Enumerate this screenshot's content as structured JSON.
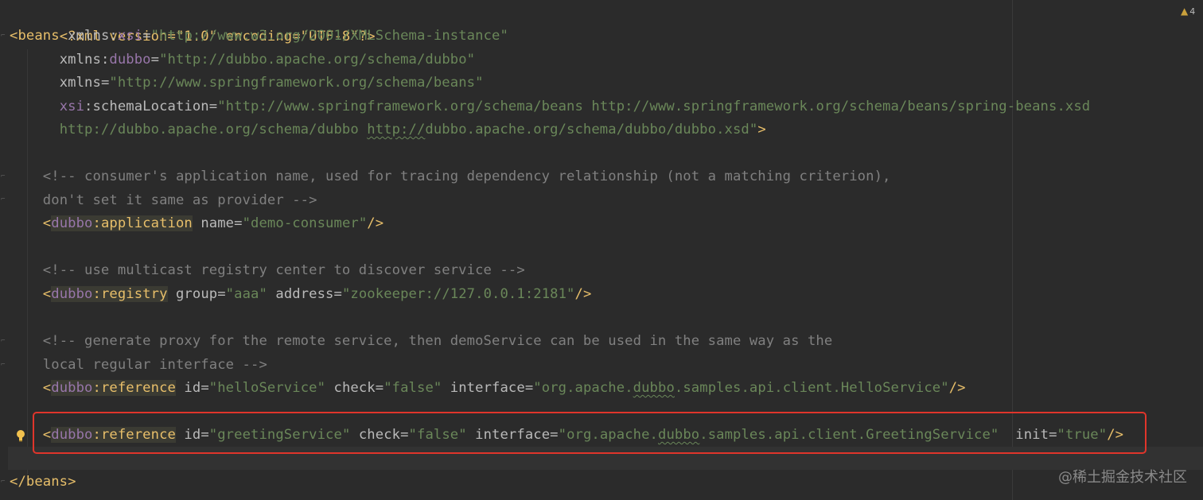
{
  "editor": {
    "warning_count": "4",
    "watermark": "@稀土掘金技术社区"
  },
  "code": {
    "l1_decl": "<?xml version=\"1.0\" encoding=\"UTF-8\"?>",
    "l2_open": "<",
    "l2_tag": "beans",
    "l2_attr_ns": "xmlns",
    "l2_colon": ":",
    "l2_xsi": "xsi",
    "l2_eq": "=",
    "l2_val": "\"http://www.w3.org/2001/XMLSchema-instance\"",
    "l3_ns": "xmlns",
    "l3_colon": ":",
    "l3_prefix": "dubbo",
    "l3_eq": "=",
    "l3_val": "\"http://dubbo.apache.org/schema/dubbo\"",
    "l4_ns": "xmlns",
    "l4_eq": "=",
    "l4_val": "\"http://www.springframework.org/schema/beans\"",
    "l5_prefix": "xsi",
    "l5_colon": ":",
    "l5_attr": "schemaLocation",
    "l5_eq": "=",
    "l5_val": "\"http://www.springframework.org/schema/beans http://www.springframework.org/schema/beans/spring-beans.xsd",
    "l6_val_a": "http://dubbo.apache.org/schema/dubbo ",
    "l6_val_b": "http://",
    "l6_val_c": "dubbo.apache.org/schema/dubbo/dubbo.xsd\"",
    "l6_close": ">",
    "l8_comment": "<!-- consumer's application name, used for tracing dependency relationship (not a matching criterion),",
    "l9_comment": "don't set it same as provider -->",
    "l10_lt": "<",
    "l10_prefix": "dubbo",
    "l10_tag": ":application",
    "l10_attr": " name",
    "l10_eq": "=",
    "l10_val": "\"demo-consumer\"",
    "l10_end": "/>",
    "l12_comment": "<!-- use multicast registry center to discover service -->",
    "l13_lt": "<",
    "l13_prefix": "dubbo",
    "l13_tag": ":registry",
    "l13_attr1": " group",
    "l13_val1": "\"aaa\"",
    "l13_attr2": " address",
    "l13_val2": "\"zookeeper://127.0.0.1:2181\"",
    "l13_end": "/>",
    "l15_comment": "<!-- generate proxy for the remote service, then demoService can be used in the same way as the",
    "l16_comment": "local regular interface -->",
    "l17_lt": "<",
    "l17_prefix": "dubbo",
    "l17_tag": ":reference",
    "l17_attr1": " id",
    "l17_val1": "\"helloService\"",
    "l17_attr2": " check",
    "l17_val2": "\"false\"",
    "l17_attr3": " interface",
    "l17_val3a": "\"org.apache.",
    "l17_val3b": "dubbo",
    "l17_val3c": ".samples.api.client.HelloService\"",
    "l17_end": "/>",
    "l19_lt": "<",
    "l19_prefix": "dubbo",
    "l19_tag": ":reference",
    "l19_attr1": " id",
    "l19_val1": "\"greetingService\"",
    "l19_attr2": " check",
    "l19_val2": "\"false\"",
    "l19_attr3": " interface",
    "l19_val3a": "\"org.apache.",
    "l19_val3b": "dubbo",
    "l19_val3c": ".samples.api.client.GreetingService\"",
    "l19_attr4": "  init",
    "l19_val4": "\"true\"",
    "l19_end": "/>",
    "l21_close": "</beans>",
    "eq": "="
  }
}
